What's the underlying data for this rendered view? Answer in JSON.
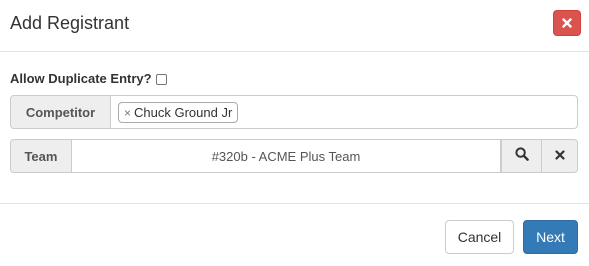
{
  "modal": {
    "title": "Add Registrant",
    "close_icon": "close-x-icon",
    "colors": {
      "danger": "#d9534f",
      "primary": "#337ab7",
      "addon_bg": "#eeeeee",
      "border": "#cccccc"
    }
  },
  "form": {
    "allow_duplicate": {
      "label": "Allow Duplicate Entry?",
      "checked": false
    },
    "competitor": {
      "label": "Competitor",
      "tags": [
        {
          "remove_glyph": "×",
          "text": "Chuck Ground Jr"
        }
      ]
    },
    "team": {
      "label": "Team",
      "value": "#320b - ACME Plus Team",
      "search_icon": "search-icon",
      "clear_icon": "clear-x-icon"
    }
  },
  "footer": {
    "cancel_label": "Cancel",
    "next_label": "Next"
  }
}
